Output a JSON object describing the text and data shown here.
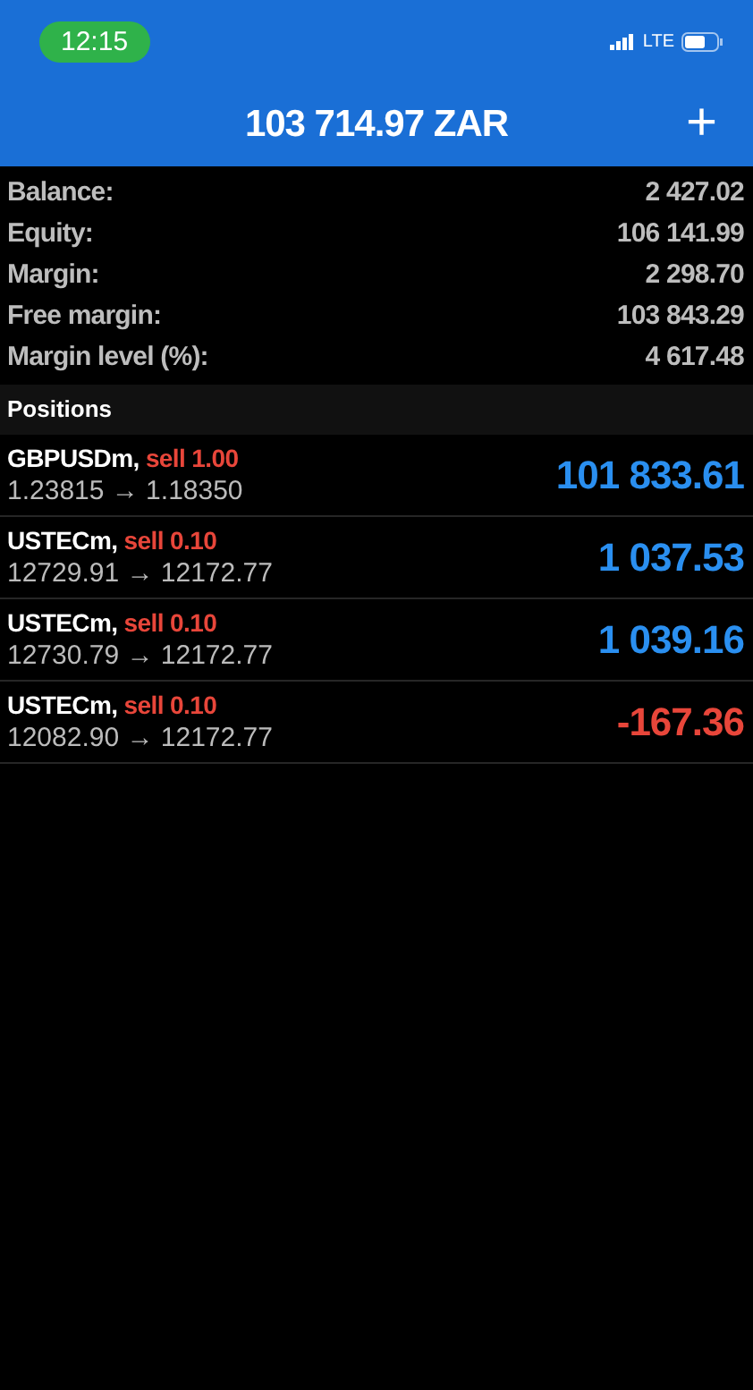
{
  "status_bar": {
    "time": "12:15",
    "network": "LTE"
  },
  "header": {
    "title": "103 714.97 ZAR",
    "add_button": "+"
  },
  "summary": [
    {
      "label": "Balance:",
      "value": "2 427.02"
    },
    {
      "label": "Equity:",
      "value": "106 141.99"
    },
    {
      "label": "Margin:",
      "value": "2 298.70"
    },
    {
      "label": "Free margin:",
      "value": "103 843.29"
    },
    {
      "label": "Margin level (%):",
      "value": "4 617.48"
    }
  ],
  "positions_heading": "Positions",
  "positions": [
    {
      "symbol": "GBPUSDm,",
      "order": "sell 1.00",
      "prices": "1.23815 → 1.18350",
      "profit": "101 833.61",
      "color": "#2a8ff0"
    },
    {
      "symbol": "USTECm,",
      "order": "sell 0.10",
      "prices": "12729.91 → 12172.77",
      "profit": "1 037.53",
      "color": "#2a8ff0"
    },
    {
      "symbol": "USTECm,",
      "order": "sell 0.10",
      "prices": "12730.79 → 12172.77",
      "profit": "1 039.16",
      "color": "#2a8ff0"
    },
    {
      "symbol": "USTECm,",
      "order": "sell 0.10",
      "prices": "12082.90 → 12172.77",
      "profit": "-167.36",
      "color": "#e8463a"
    }
  ]
}
